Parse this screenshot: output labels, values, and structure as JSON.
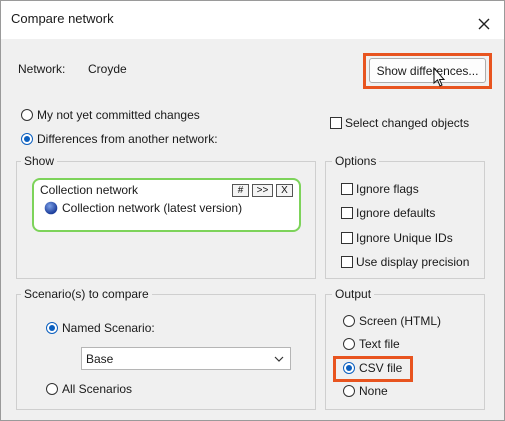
{
  "window": {
    "title": "Compare network"
  },
  "network": {
    "label": "Network:",
    "value": "Croyde"
  },
  "show_differences_label": "Show differences...",
  "compare_mode": {
    "options": [
      {
        "label": "My not yet committed changes",
        "selected": false
      },
      {
        "label": "Differences from another network:",
        "selected": true
      }
    ]
  },
  "select_changed_objects": {
    "label": "Select changed objects",
    "checked": false
  },
  "show": {
    "title": "Show",
    "collection": {
      "header": "Collection network",
      "buttons": [
        "#",
        ">>",
        "X"
      ],
      "item": "Collection network (latest version)",
      "item_icon": "network-globe-icon"
    }
  },
  "options": {
    "title": "Options",
    "items": [
      {
        "label": "Ignore flags",
        "checked": false
      },
      {
        "label": "Ignore defaults",
        "checked": false
      },
      {
        "label": "Ignore Unique IDs",
        "checked": false
      },
      {
        "label": "Use display precision",
        "checked": false
      }
    ]
  },
  "scenarios": {
    "title": "Scenario(s) to compare",
    "named_label": "Named Scenario:",
    "named_selected": true,
    "scenario_value": "Base",
    "all_label": "All Scenarios",
    "all_selected": false
  },
  "output": {
    "title": "Output",
    "items": [
      {
        "label": "Screen (HTML)",
        "selected": false
      },
      {
        "label": "Text file",
        "selected": false
      },
      {
        "label": "CSV file",
        "selected": true
      },
      {
        "label": "None",
        "selected": false
      }
    ]
  },
  "colors": {
    "highlight": "#e8541f",
    "accent": "#0b5fbf",
    "collection_border": "#7dd35a"
  }
}
